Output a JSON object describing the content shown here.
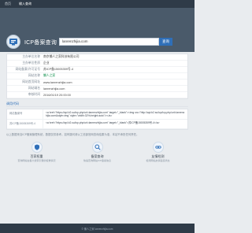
{
  "nav": {
    "home": "首页",
    "current": "输入查询"
  },
  "hero": {
    "title": "ICP备案查询",
    "search_value": "lanrenzhijia.com",
    "search_button": "查询"
  },
  "info": [
    {
      "key": "主办单位名称",
      "value": "南京懒人之家科技有限公司"
    },
    {
      "key": "主办单位性质",
      "value": "企业"
    },
    {
      "key": "网站备案/许可证号",
      "value": "苏ICP备15005359号-4"
    },
    {
      "key": "网站名称",
      "value": "懒人之家",
      "badge": true
    },
    {
      "key": "网站首页网址",
      "value": "www.lanrenzhijia.com"
    },
    {
      "key": "网站域名",
      "value": "lanrenzhijia.com"
    },
    {
      "key": "审核时间",
      "value": "2016/01/19 20:00:00"
    }
  ],
  "section_title": "调用代码",
  "code": [
    {
      "key": "网站备案号",
      "value": "<a href=\"https://api.b2.su/icp.php/url=lanrenzhijia.com\" target=\"_blank\"><img src=\"http://api.b2.su/icp/icp.php/url=lanrenzhijia.com&style=img\" style=\"width:32%;height:auto\"/></a>"
    },
    {
      "key": "苏ICP备15005359号-4",
      "value": "<a href=\"https://api.b2.su/icp.php/url=lanrenzhijia.com\" target=\"_blank\">苏ICP备15005359号-4</a>"
    }
  ],
  "note": "以上数据来自ICP备案管理系统，数据仅供参考。如有疑问请以工信部官网查询结果为准，本站不承担任何责任。",
  "features": [
    {
      "title": "百家权重",
      "desc": "查询网站在各大搜索引擎的权重情况",
      "icon": "shield-icon"
    },
    {
      "title": "备案查询",
      "desc": "快速查询网站ICP备案信息",
      "icon": "search-icon"
    },
    {
      "title": "友情检测",
      "desc": "检测网站友情链接状态",
      "icon": "link-icon"
    }
  ],
  "footer": "© 懒人之家 lanrenzhijia.com"
}
